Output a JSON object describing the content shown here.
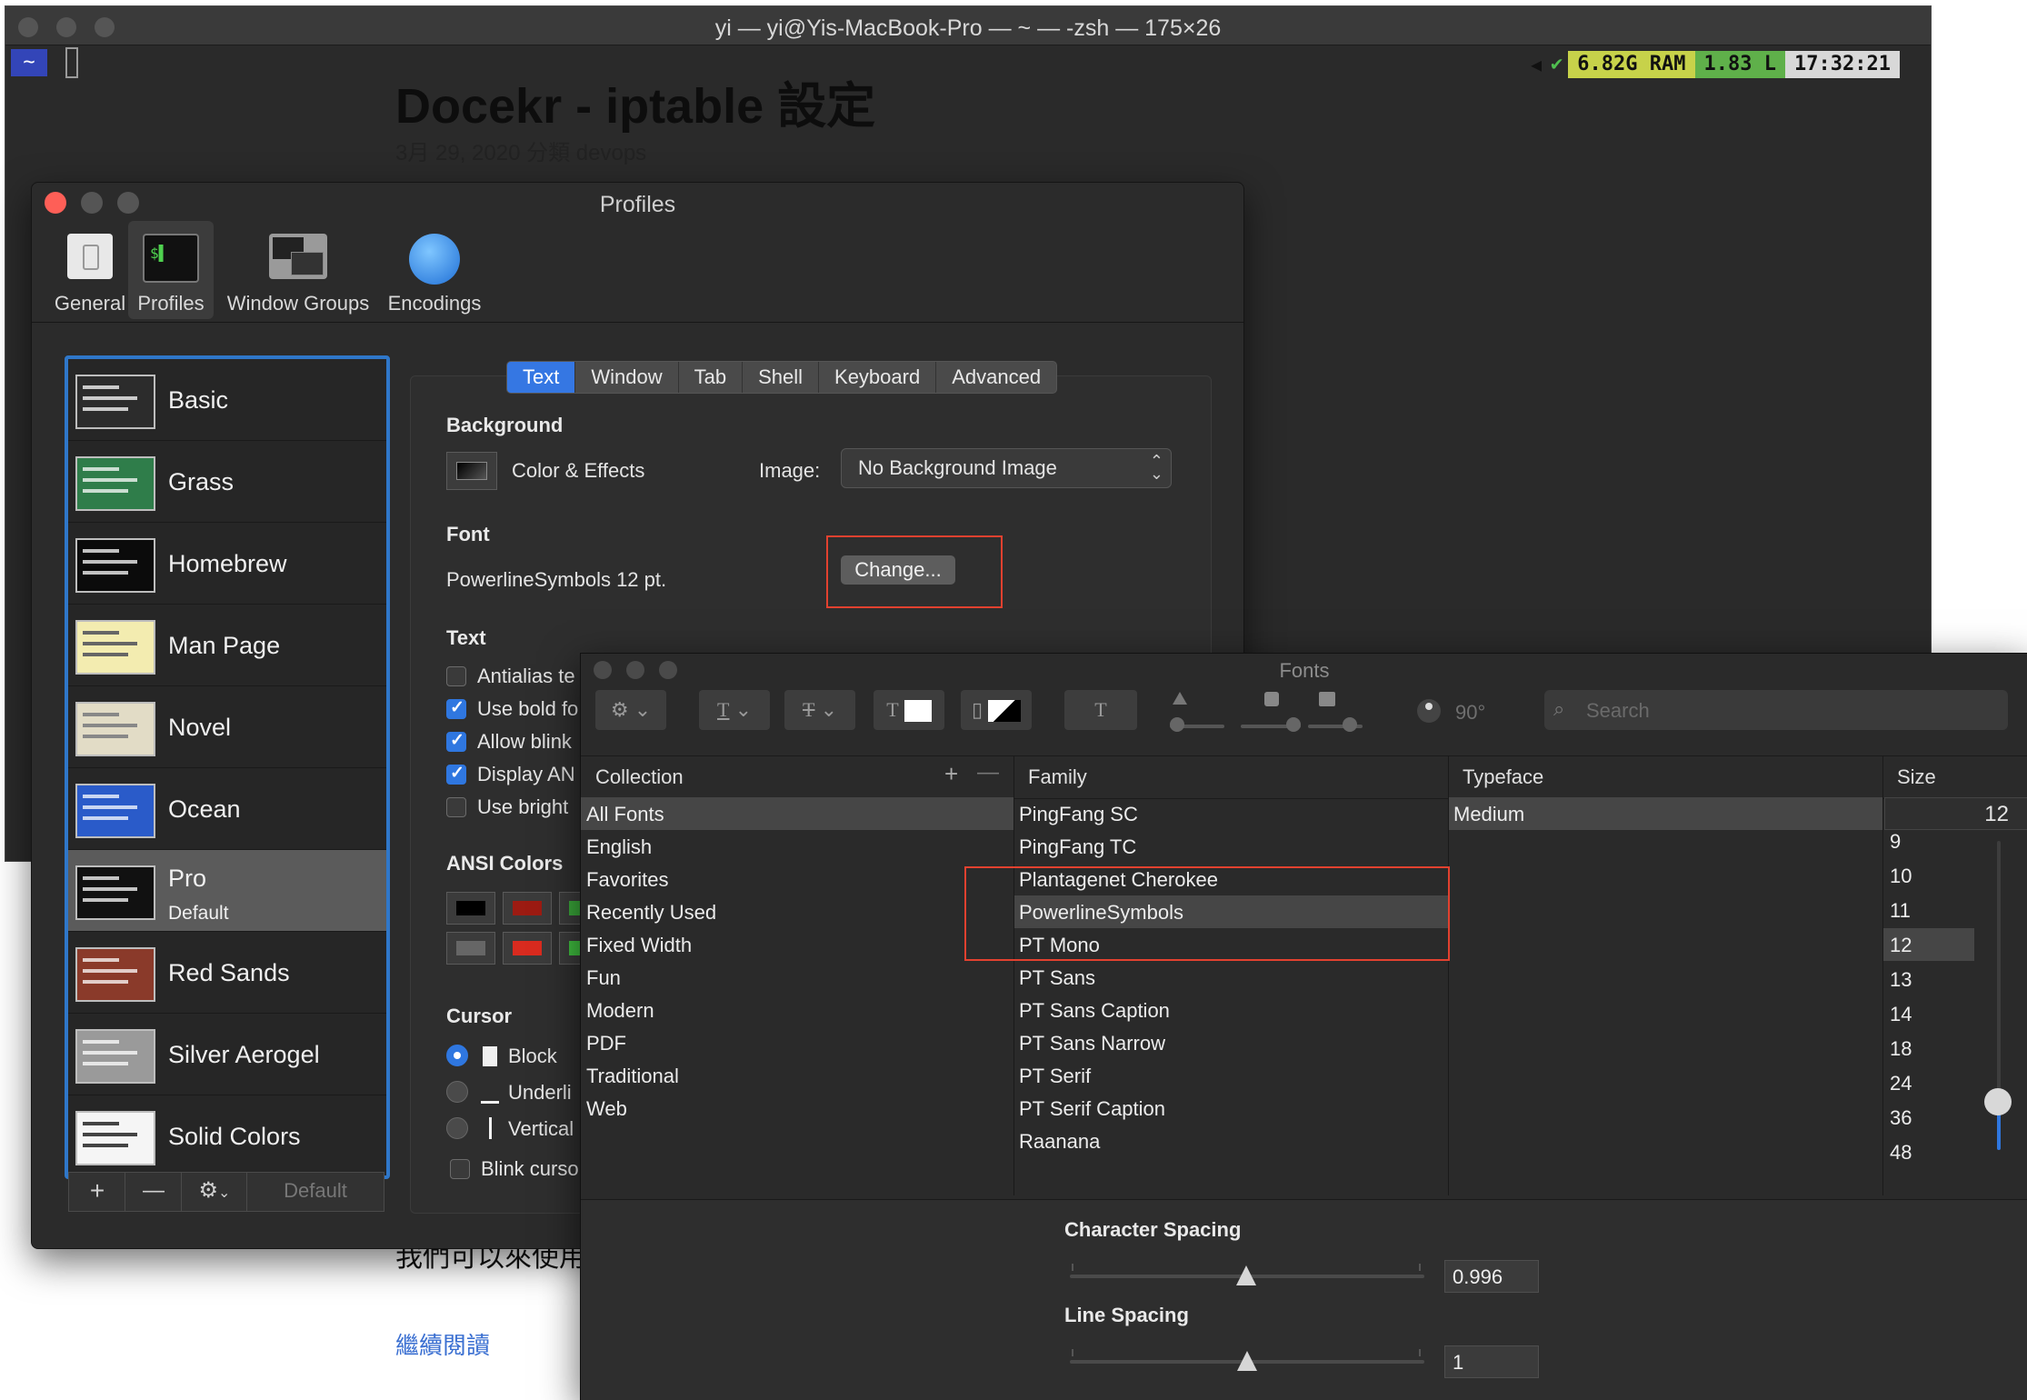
{
  "terminal": {
    "title": "yi — yi@Yis-MacBook-Pro — ~ — -zsh — 175×26",
    "prompt_dir": "~",
    "status": {
      "ram": "6.82G RAM",
      "load": "1.83 L",
      "time": "17:32:21",
      "check": "✔"
    }
  },
  "blog": {
    "title": "Docekr - iptable 設定",
    "meta": "3月 29, 2020 分類 devops",
    "garbled": "我們可以來使用",
    "read_more": "繼續閱讀"
  },
  "profiles_window": {
    "title": "Profiles",
    "toolbar": [
      {
        "label": "General"
      },
      {
        "label": "Profiles"
      },
      {
        "label": "Window Groups"
      },
      {
        "label": "Encodings"
      }
    ],
    "profiles": [
      {
        "name": "Basic",
        "color": "#2c2c2c"
      },
      {
        "name": "Grass",
        "color": "#2f7d4a"
      },
      {
        "name": "Homebrew",
        "color": "#0b0b0b"
      },
      {
        "name": "Man Page",
        "color": "#f3ecb0"
      },
      {
        "name": "Novel",
        "color": "#e2dcc6"
      },
      {
        "name": "Ocean",
        "color": "#2a5bc9"
      },
      {
        "name": "Pro",
        "subtitle": "Default",
        "color": "#111111"
      },
      {
        "name": "Red Sands",
        "color": "#8a3a2a"
      },
      {
        "name": "Silver Aerogel",
        "color": "#9a9a9a"
      },
      {
        "name": "Solid Colors",
        "color": "#f5f5f5"
      }
    ],
    "footer": {
      "add": "+",
      "remove": "—",
      "gear": "⚙︎",
      "default_label": "Default"
    },
    "tabs": [
      "Text",
      "Window",
      "Tab",
      "Shell",
      "Keyboard",
      "Advanced"
    ],
    "active_tab": "Text",
    "background": {
      "heading": "Background",
      "color_effects": "Color & Effects",
      "image_label": "Image:",
      "image_value": "No Background Image"
    },
    "font": {
      "heading": "Font",
      "current": "PowerlineSymbols 12 pt.",
      "change_button": "Change..."
    },
    "text": {
      "heading": "Text",
      "options": [
        {
          "label": "Antialias te",
          "checked": false
        },
        {
          "label": "Use bold fo",
          "checked": true
        },
        {
          "label": "Allow blink",
          "checked": true
        },
        {
          "label": "Display AN",
          "checked": true
        },
        {
          "label": "Use bright",
          "checked": false
        }
      ]
    },
    "ansi": {
      "heading": "ANSI Colors"
    },
    "cursor": {
      "heading": "Cursor",
      "options": [
        {
          "label": "Block",
          "selected": true
        },
        {
          "label": "Underli",
          "selected": false
        },
        {
          "label": "Vertical",
          "selected": false
        }
      ],
      "blink": "Blink curso"
    }
  },
  "fonts_panel": {
    "title": "Fonts",
    "search_placeholder": "Search",
    "rotation": "90°",
    "columns": {
      "collection": "Collection",
      "family": "Family",
      "typeface": "Typeface",
      "size": "Size"
    },
    "collections": [
      "All Fonts",
      "English",
      "Favorites",
      "Recently Used",
      "Fixed Width",
      "Fun",
      "Modern",
      "PDF",
      "Traditional",
      "Web"
    ],
    "selected_collection": "All Fonts",
    "families": [
      "PingFang SC",
      "PingFang TC",
      "Plantagenet Cherokee",
      "PowerlineSymbols",
      "PT Mono",
      "PT Sans",
      "PT Sans Caption",
      "PT Sans Narrow",
      "PT Serif",
      "PT Serif Caption",
      "Raanana"
    ],
    "selected_family": "PowerlineSymbols",
    "typefaces": [
      "Medium"
    ],
    "size_value": "12",
    "sizes": [
      "9",
      "10",
      "11",
      "12",
      "13",
      "14",
      "18",
      "24",
      "36",
      "48"
    ],
    "selected_size": "12",
    "character_spacing": {
      "label": "Character Spacing",
      "value": "0.996",
      "fraction": 0.5
    },
    "line_spacing": {
      "label": "Line Spacing",
      "value": "1",
      "fraction": 0.5
    }
  },
  "colors": {
    "accent": "#2f77e0",
    "highlight_box": "#e2412f",
    "ram_badge": "#c7d24a",
    "load_badge": "#5fb04a",
    "time_badge": "#d8d8d8"
  }
}
